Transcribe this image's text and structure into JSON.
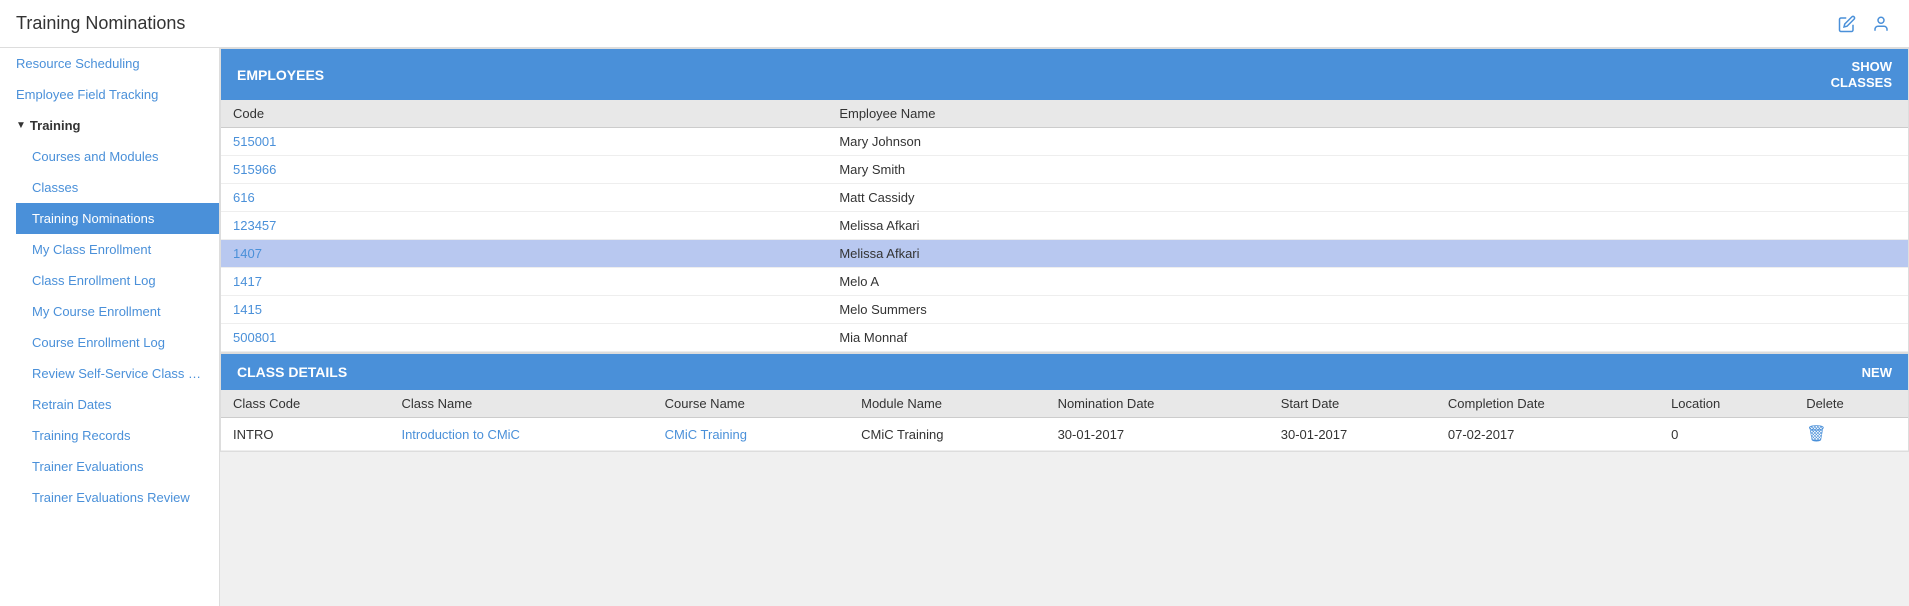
{
  "header": {
    "title": "Training Nominations",
    "edit_icon": "✎",
    "user_icon": "👤"
  },
  "sidebar": {
    "items": [
      {
        "id": "resource-scheduling",
        "label": "Resource Scheduling",
        "active": false,
        "indented": false
      },
      {
        "id": "employee-field-tracking",
        "label": "Employee Field Tracking",
        "active": false,
        "indented": false
      },
      {
        "id": "training-section",
        "label": "Training",
        "type": "section"
      },
      {
        "id": "courses-and-modules",
        "label": "Courses and Modules",
        "active": false,
        "indented": true
      },
      {
        "id": "classes",
        "label": "Classes",
        "active": false,
        "indented": true
      },
      {
        "id": "training-nominations",
        "label": "Training Nominations",
        "active": true,
        "indented": true
      },
      {
        "id": "my-class-enrollment",
        "label": "My Class Enrollment",
        "active": false,
        "indented": true
      },
      {
        "id": "class-enrollment-log",
        "label": "Class Enrollment Log",
        "active": false,
        "indented": true
      },
      {
        "id": "my-course-enrollment",
        "label": "My Course Enrollment",
        "active": false,
        "indented": true
      },
      {
        "id": "course-enrollment-log",
        "label": "Course Enrollment Log",
        "active": false,
        "indented": true
      },
      {
        "id": "review-self-service",
        "label": "Review Self-Service Class Enrollm",
        "active": false,
        "indented": true
      },
      {
        "id": "retrain-dates",
        "label": "Retrain Dates",
        "active": false,
        "indented": true
      },
      {
        "id": "training-records",
        "label": "Training Records",
        "active": false,
        "indented": true
      },
      {
        "id": "trainer-evaluations",
        "label": "Trainer Evaluations",
        "active": false,
        "indented": true
      },
      {
        "id": "trainer-evaluations-review",
        "label": "Trainer Evaluations Review",
        "active": false,
        "indented": true
      }
    ]
  },
  "employees_panel": {
    "title": "EMPLOYEES",
    "show_classes_label": "SHOW\nCLASSES",
    "columns": [
      {
        "key": "code",
        "label": "Code"
      },
      {
        "key": "name",
        "label": "Employee Name"
      }
    ],
    "rows": [
      {
        "code": "515001",
        "name": "Mary Johnson",
        "highlighted": false
      },
      {
        "code": "515966",
        "name": "Mary Smith",
        "highlighted": false
      },
      {
        "code": "616",
        "name": "Matt Cassidy",
        "highlighted": false
      },
      {
        "code": "123457",
        "name": "Melissa Afkari",
        "highlighted": false
      },
      {
        "code": "1407",
        "name": "Melissa Afkari",
        "highlighted": true
      },
      {
        "code": "1417",
        "name": "Melo A",
        "highlighted": false
      },
      {
        "code": "1415",
        "name": "Melo Summers",
        "highlighted": false
      },
      {
        "code": "500801",
        "name": "Mia Monnaf",
        "highlighted": false
      }
    ]
  },
  "class_details_panel": {
    "title": "CLASS DETAILS",
    "new_label": "NEW",
    "columns": [
      {
        "key": "class_code",
        "label": "Class Code"
      },
      {
        "key": "class_name",
        "label": "Class Name"
      },
      {
        "key": "course_name",
        "label": "Course Name"
      },
      {
        "key": "module_name",
        "label": "Module Name"
      },
      {
        "key": "nomination_date",
        "label": "Nomination Date"
      },
      {
        "key": "start_date",
        "label": "Start Date"
      },
      {
        "key": "completion_date",
        "label": "Completion Date"
      },
      {
        "key": "location",
        "label": "Location"
      },
      {
        "key": "delete",
        "label": "Delete"
      }
    ],
    "rows": [
      {
        "class_code": "INTRO",
        "class_name": "Introduction to CMiC",
        "course_name": "CMiC Training",
        "module_name": "CMiC Training",
        "nomination_date": "30-01-2017",
        "start_date": "30-01-2017",
        "completion_date": "07-02-2017",
        "location": "0",
        "delete": "🗑"
      }
    ]
  }
}
